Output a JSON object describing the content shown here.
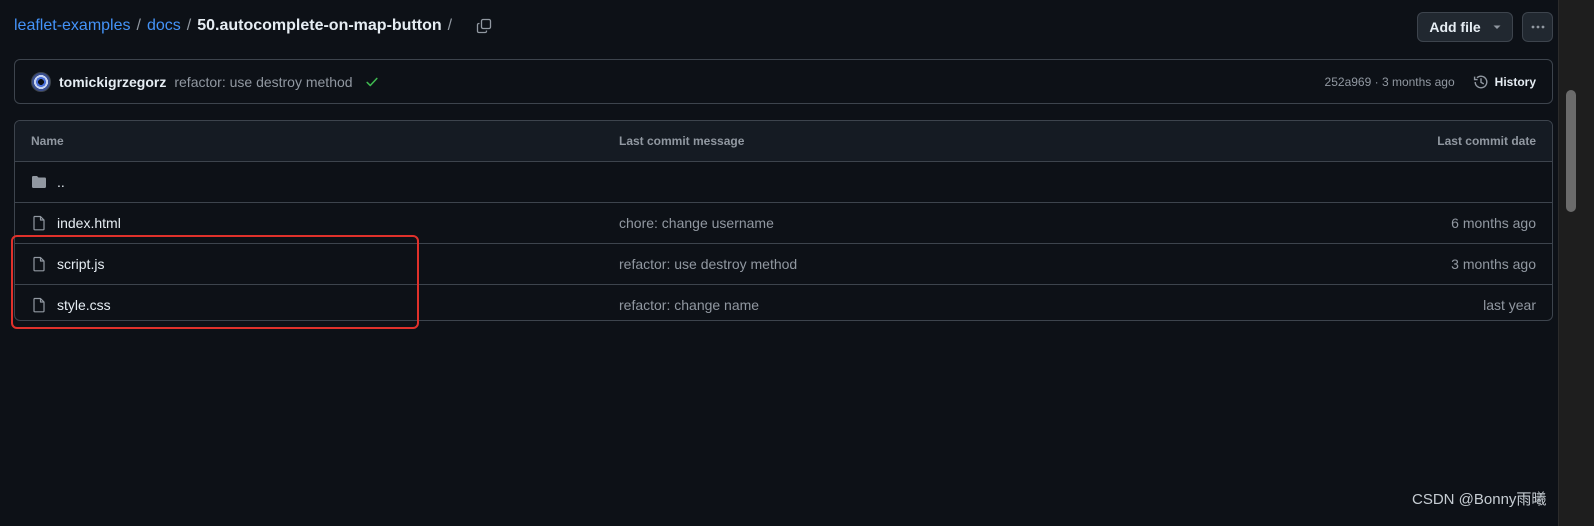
{
  "breadcrumb": {
    "repo": "leaflet-examples",
    "folder": "docs",
    "current": "50.autocomplete-on-map-button",
    "separator": "/"
  },
  "actions": {
    "add_file_label": "Add file",
    "more_icon": "kebab-horizontal-icon",
    "copy_icon": "copy-icon"
  },
  "commit": {
    "author": "tomickigrzegorz",
    "message": "refactor: use destroy method",
    "status_icon": "check-icon",
    "status_color": "#3fb950",
    "sha": "252a969",
    "age": "3 months ago",
    "history_label": "History"
  },
  "table": {
    "headers": {
      "name": "Name",
      "message": "Last commit message",
      "date": "Last commit date"
    },
    "parent_dir": "..",
    "rows": [
      {
        "name": "index.html",
        "message": "chore: change username",
        "date": "6 months ago",
        "icon": "file-icon"
      },
      {
        "name": "script.js",
        "message": "refactor: use destroy method",
        "date": "3 months ago",
        "icon": "file-icon"
      },
      {
        "name": "style.css",
        "message": "refactor: change name",
        "date": "last year",
        "icon": "file-icon"
      }
    ]
  },
  "colors": {
    "background": "#0d1117",
    "link": "#4493f8",
    "highlight": "#e0312b"
  },
  "watermark": "CSDN @Bonny雨曦"
}
